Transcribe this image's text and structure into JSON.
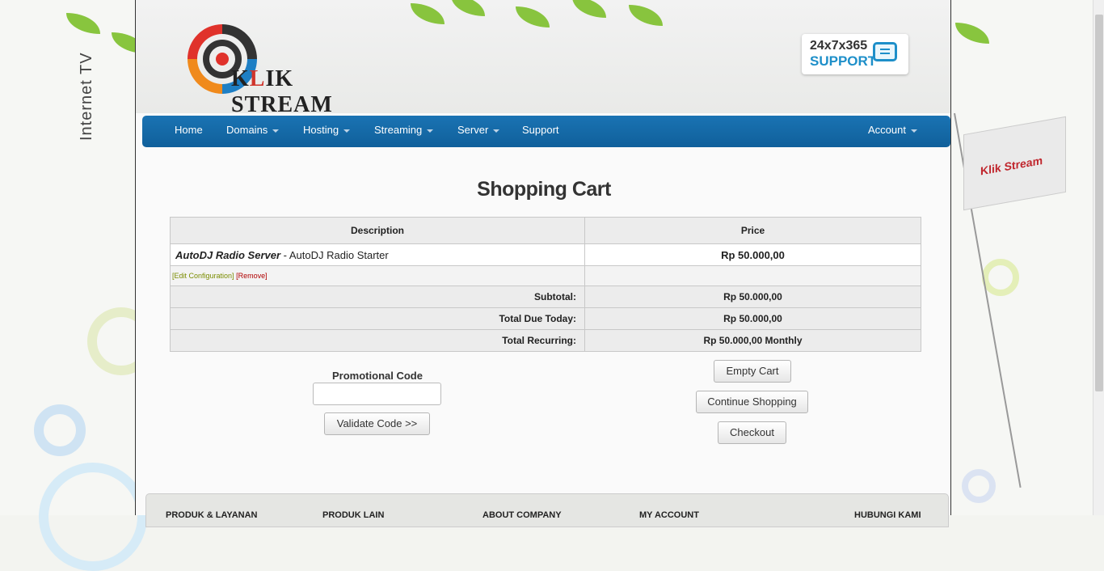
{
  "side": {
    "left_text": "Internet TV",
    "flag_text": "Klik Stream"
  },
  "header": {
    "logo": {
      "part1": "K",
      "red": "L",
      "part2": "IK STREAM"
    },
    "support": {
      "line1": "24x7x365",
      "line2": "SUPPORT",
      "icon": "chat-monitor-icon"
    }
  },
  "nav": {
    "items": [
      {
        "label": "Home",
        "dropdown": false
      },
      {
        "label": "Domains",
        "dropdown": true
      },
      {
        "label": "Hosting",
        "dropdown": true
      },
      {
        "label": "Streaming",
        "dropdown": true
      },
      {
        "label": "Server",
        "dropdown": true
      },
      {
        "label": "Support",
        "dropdown": false
      }
    ],
    "account": {
      "label": "Account",
      "dropdown": true
    }
  },
  "cart": {
    "title": "Shopping Cart",
    "columns": {
      "description": "Description",
      "price": "Price"
    },
    "item": {
      "product": "AutoDJ Radio Server",
      "separator": " - ",
      "plan": "AutoDJ Radio Starter",
      "price": "Rp 50.000,00",
      "edit": "[Edit Configuration]",
      "remove": "[Remove]"
    },
    "subtotal": {
      "label": "Subtotal:",
      "value": "Rp 50.000,00"
    },
    "due_today": {
      "label": "Total Due Today:",
      "value": "Rp 50.000,00"
    },
    "recurring": {
      "label": "Total Recurring:",
      "value": "Rp 50.000,00 Monthly"
    }
  },
  "promo": {
    "label": "Promotional Code",
    "value": "",
    "validate": "Validate Code >>"
  },
  "buttons": {
    "empty": "Empty Cart",
    "continue": "Continue Shopping",
    "checkout": "Checkout"
  },
  "footer": {
    "columns": [
      "PRODUK & LAYANAN",
      "PRODUK LAIN",
      "ABOUT COMPANY",
      "MY ACCOUNT",
      "HUBUNGI KAMI"
    ]
  },
  "colors": {
    "nav": "#1669a8",
    "accent": "#1e8fc9",
    "logo_red": "#d0352c"
  }
}
